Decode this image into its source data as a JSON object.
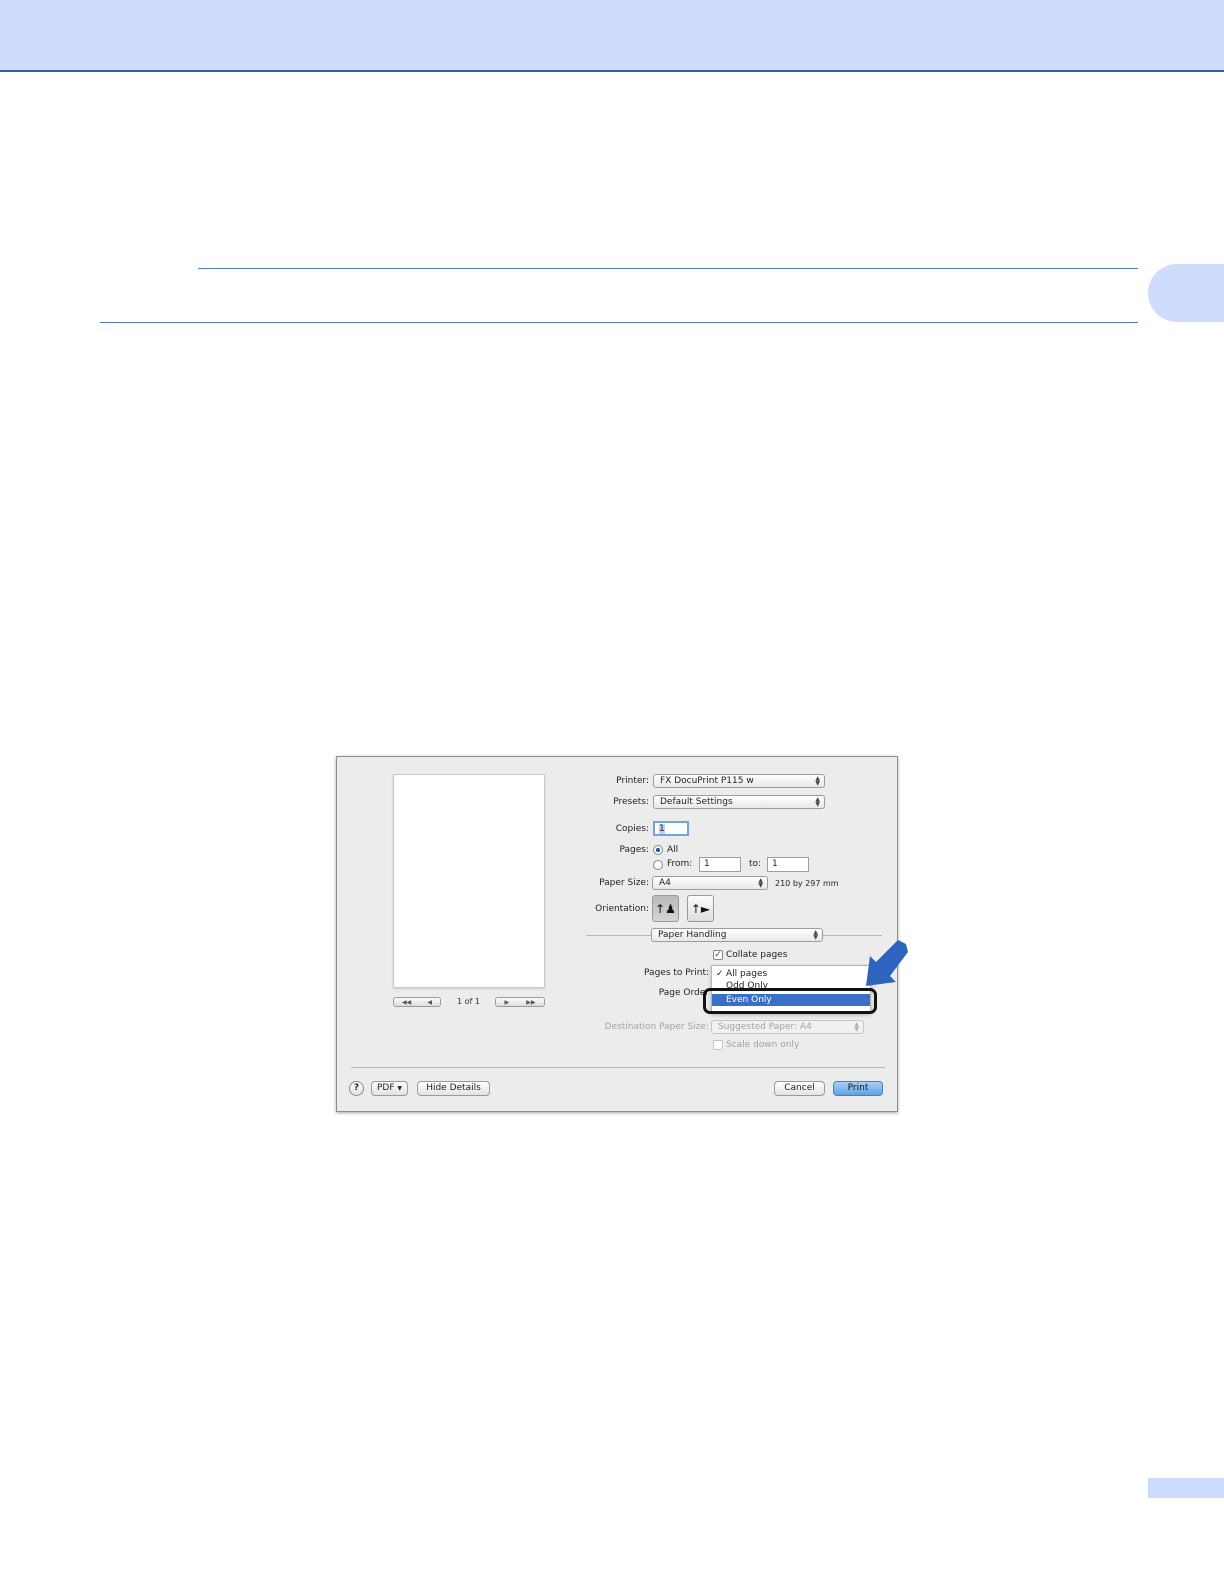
{
  "dialog": {
    "preview": {
      "page_indicator": "1 of 1"
    },
    "printer": {
      "label": "Printer:",
      "value": "FX DocuPrint P115 w"
    },
    "presets": {
      "label": "Presets:",
      "value": "Default Settings"
    },
    "copies": {
      "label": "Copies:",
      "value": "1"
    },
    "pages": {
      "label": "Pages:",
      "all_label": "All",
      "from_label": "From:",
      "from_value": "1",
      "to_label": "to:",
      "to_value": "1"
    },
    "paper_size": {
      "label": "Paper Size:",
      "value": "A4",
      "dimensions": "210 by 297 mm"
    },
    "orientation": {
      "label": "Orientation:"
    },
    "section_popup": {
      "value": "Paper Handling"
    },
    "collate": {
      "label": "Collate pages",
      "checked": true
    },
    "pages_to_print": {
      "label": "Pages to Print:",
      "menu": [
        {
          "label": "All pages",
          "checked": true
        },
        {
          "label": "Odd Only",
          "checked": false
        },
        {
          "label": "Even Only",
          "highlighted": true
        }
      ]
    },
    "page_order": {
      "label": "Page Order"
    },
    "destination_paper_size": {
      "label": "Destination Paper Size:",
      "value": "Suggested Paper: A4"
    },
    "scale_down": {
      "label": "Scale down only"
    },
    "footer": {
      "help": "?",
      "pdf": "PDF",
      "hide_details": "Hide Details",
      "cancel": "Cancel",
      "print": "Print"
    }
  },
  "colors": {
    "header_band": "#cddcfa",
    "rule": "#4f7ad0",
    "highlight": "#3a6fc8",
    "arrow": "#2f63c0"
  }
}
